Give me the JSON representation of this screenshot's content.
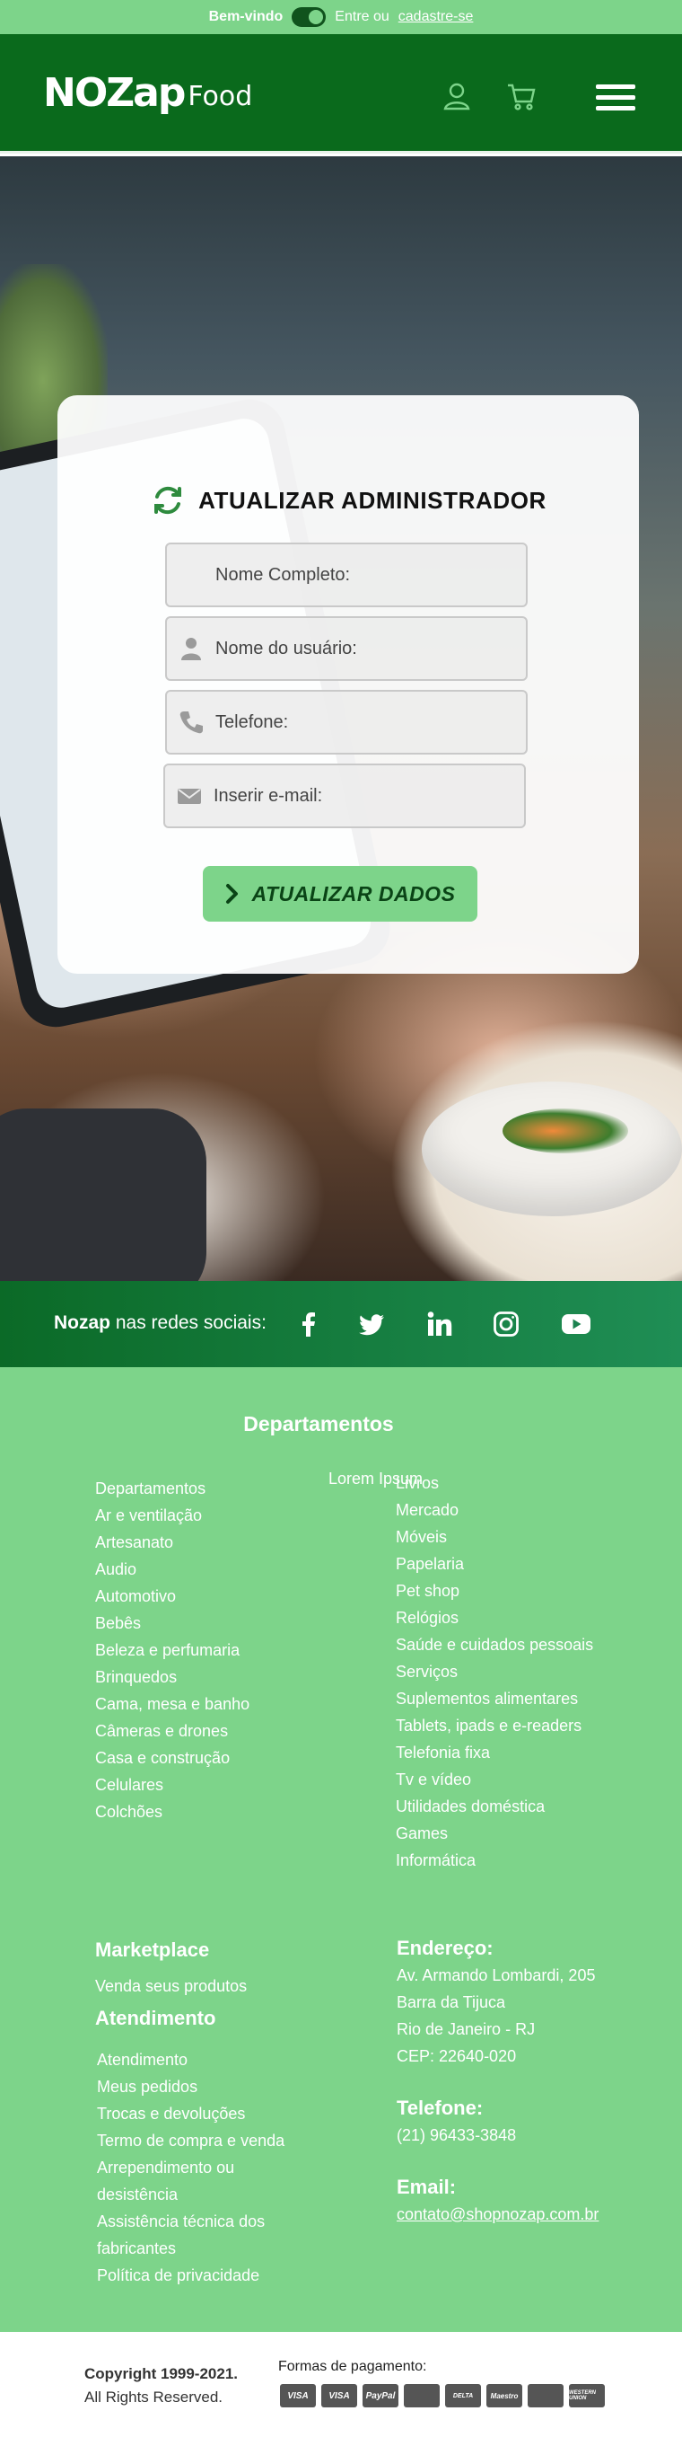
{
  "topbar": {
    "welcome": "Bem-vindo",
    "login_text": "Entre ou",
    "signup_link": "cadastre-se"
  },
  "header": {
    "logo_brand": "NOZap",
    "logo_food": "Food",
    "icons": [
      "user-icon",
      "cart-icon",
      "menu-icon"
    ]
  },
  "form": {
    "title": "ATUALIZAR ADMINISTRADOR",
    "fields": [
      {
        "placeholder": "Nome Completo:"
      },
      {
        "placeholder": "Nome do usuário:"
      },
      {
        "placeholder": "Telefone:"
      },
      {
        "placeholder": "Inserir e-mail:"
      }
    ],
    "submit_label": "ATUALIZAR DADOS"
  },
  "social": {
    "brand": "Nozap",
    "label": " nas redes sociais:",
    "networks": [
      "facebook",
      "twitter",
      "linkedin",
      "instagram",
      "youtube"
    ]
  },
  "footer": {
    "departments_title": "Departamentos",
    "lorem": "Lorem Ipsum",
    "col1": [
      "Departamentos",
      "Ar e ventilação",
      "Artesanato",
      "Audio",
      "Automotivo",
      "Bebês",
      "Beleza e perfumaria",
      "Brinquedos",
      "Cama, mesa e banho",
      "Câmeras e drones",
      "Casa e construção",
      "Celulares",
      "Colchões"
    ],
    "col2": [
      "Livros",
      "Mercado",
      "Móveis",
      "Papelaria",
      "Pet shop",
      "Relógios",
      "Saúde e cuidados pessoais",
      "Serviços",
      "Suplementos alimentares",
      "Tablets, ipads e e-readers",
      "Telefonia fixa",
      "Tv e vídeo",
      "Utilidades doméstica",
      "Games",
      "Informática"
    ],
    "marketplace_title": "Marketplace",
    "marketplace_link": "Venda seus produtos",
    "atendimento_title": "Atendimento",
    "atendimento_links": [
      "Atendimento",
      "Meus pedidos",
      "Trocas e devoluções",
      "Termo de compra e venda",
      "Arrependimento ou",
      "desistência",
      "Assistência técnica dos",
      "fabricantes",
      "Política de privacidade"
    ],
    "endereco_title": "Endereço:",
    "endereco_lines": [
      "Av. Armando Lombardi, 205",
      "Barra da Tijuca",
      "Rio de Janeiro - RJ",
      "CEP: 22640-020"
    ],
    "telefone_title": "Telefone:",
    "telefone": "(21) 96433-3848",
    "email_title": "Email:",
    "email": "contato@shopnozap.com.br"
  },
  "bottom": {
    "copyright": "Copyright 1999-2021.",
    "rights": "All Rights Reserved.",
    "payment_label": "Formas de pagamento:",
    "payment_methods": [
      "VISA",
      "VISA",
      "PayPal",
      "mastercard",
      "DELTA",
      "Maestro",
      "mastercard",
      "WESTERN UNION"
    ]
  },
  "colors": {
    "dark_green": "#0a6a1c",
    "light_green": "#7dd48a",
    "accent_icon": "#2e8b3e"
  }
}
